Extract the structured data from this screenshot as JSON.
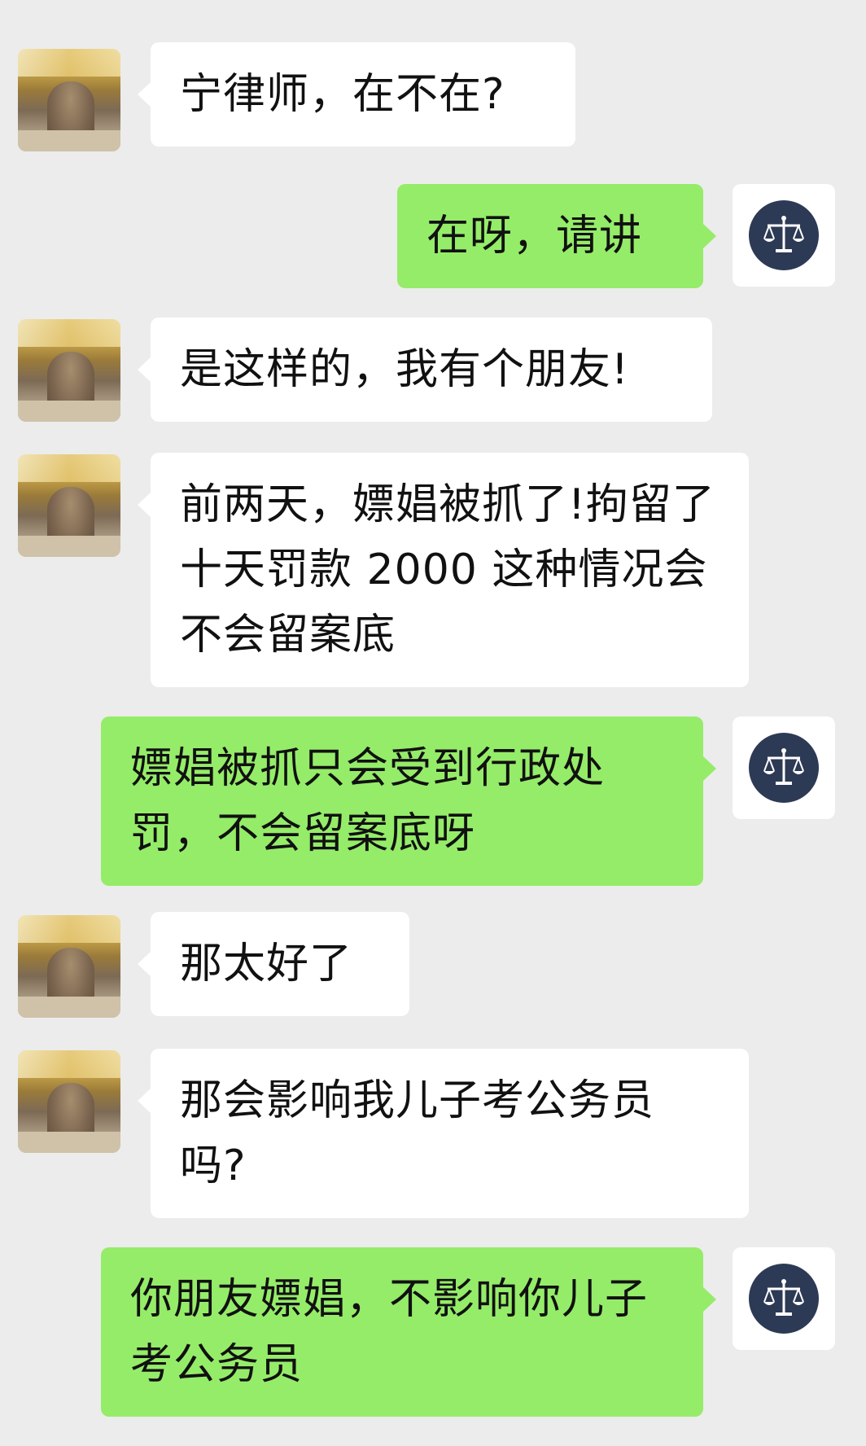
{
  "chat": {
    "messages": [
      {
        "side": "left",
        "text": "宁律师，在不在?"
      },
      {
        "side": "right",
        "text": "在呀，请讲"
      },
      {
        "side": "left",
        "text": "是这样的，我有个朋友!"
      },
      {
        "side": "left",
        "text": "前两天，嫖娼被抓了!拘留了十天罚款 2000 这种情况会不会留案底"
      },
      {
        "side": "right",
        "text": "嫖娼被抓只会受到行政处罚，不会留案底呀"
      },
      {
        "side": "left",
        "text": "那太好了"
      },
      {
        "side": "left",
        "text": "那会影响我儿子考公务员吗?"
      },
      {
        "side": "right",
        "text": "你朋友嫖娼，不影响你儿子考公务员"
      }
    ]
  },
  "avatars": {
    "left": "user-photo-avatar",
    "right": "scale-of-justice-icon"
  },
  "colors": {
    "background": "#ececec",
    "left_bubble": "#ffffff",
    "right_bubble": "#95ec69",
    "lawyer_avatar": "#2d3a55"
  }
}
